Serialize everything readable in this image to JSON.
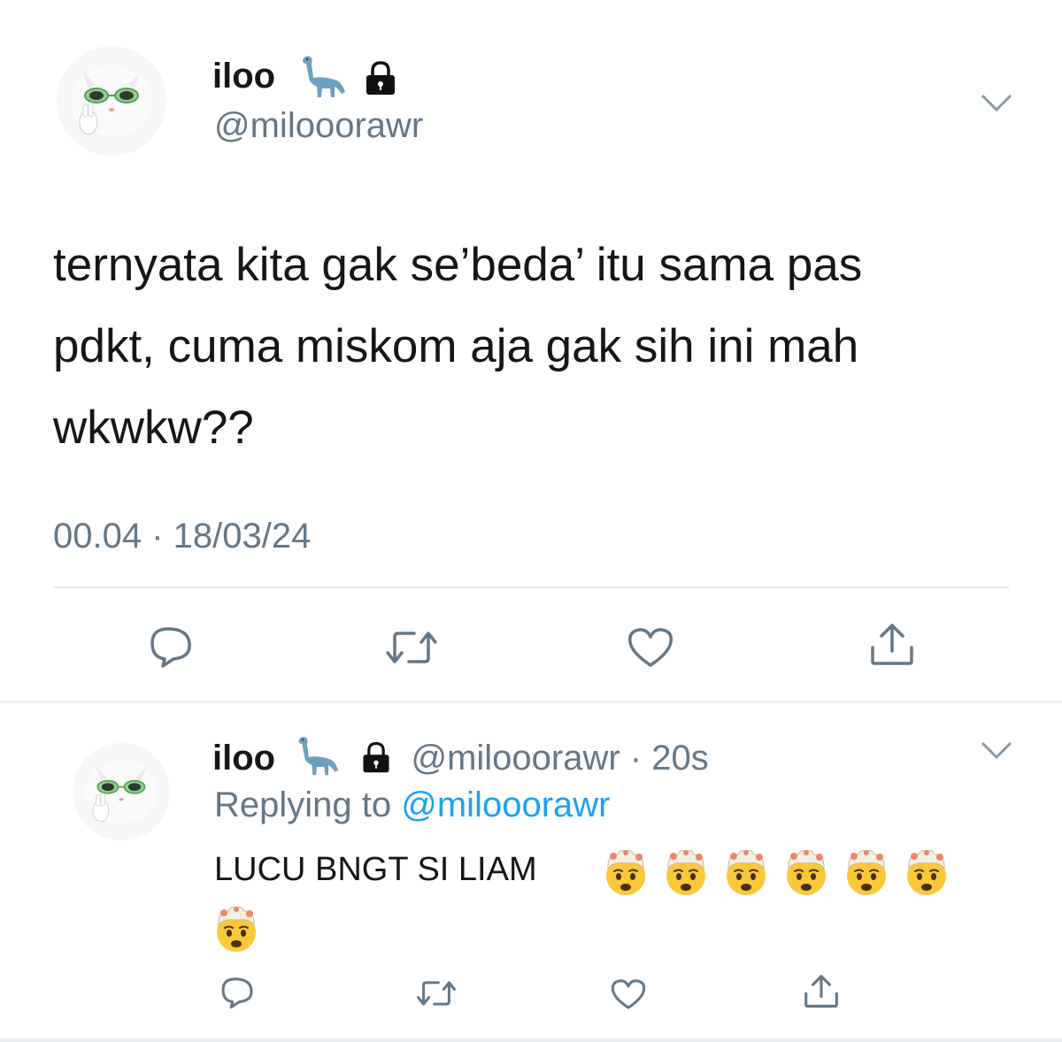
{
  "main_tweet": {
    "display_name": "iloo",
    "name_emoji": "sauropod-emoji",
    "lock_icon": "lock-icon",
    "handle": "@milooorawr",
    "text_line1": "ternyata kita gak se’beda’ itu sama pas",
    "text_line2": "pdkt, cuma miskom aja gak sih ini mah",
    "text_line3": "wkwkw??",
    "timestamp": "00.04 · 18/03/24",
    "actions": [
      "reply-icon",
      "retweet-icon",
      "like-icon",
      "share-icon"
    ],
    "menu_icon": "chevron-down-icon"
  },
  "reply_tweet": {
    "display_name": "iloo",
    "name_emoji": "sauropod-emoji",
    "lock_icon": "lock-icon",
    "handle_time": "@milooorawr · 20s",
    "replying_prefix": "Replying to",
    "replying_handle": "@milooorawr",
    "text": "LUCU BNGT SI LIAM",
    "reaction_emoji": "exploding-head-emoji",
    "reaction_count": 7,
    "actions": [
      "reply-icon",
      "retweet-icon",
      "like-icon",
      "share-icon"
    ],
    "menu_icon": "chevron-down-icon"
  },
  "colors": {
    "text_primary": "#14171a",
    "text_secondary": "#657786",
    "link": "#1da1f2",
    "divider": "#e1e8ed"
  }
}
